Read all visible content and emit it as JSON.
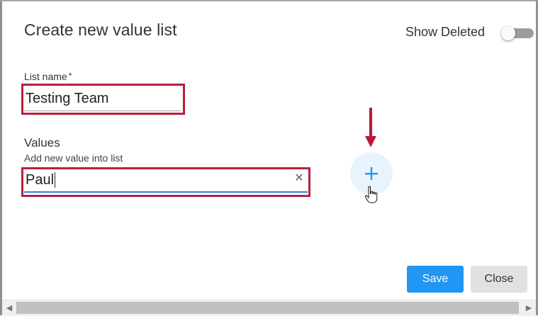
{
  "dialog": {
    "title": "Create new value list",
    "show_deleted_label": "Show Deleted",
    "show_deleted_on": false
  },
  "list_name": {
    "label": "List name",
    "required_mark": "*",
    "value": "Testing Team"
  },
  "values": {
    "heading": "Values",
    "input_label": "Add new value into list",
    "input_value": "Paul",
    "clear_icon": "close-icon",
    "add_icon": "plus-icon"
  },
  "footer": {
    "save_label": "Save",
    "close_label": "Close"
  },
  "colors": {
    "highlight": "#b5213f",
    "primary": "#2196f3",
    "underline_focus": "#2f7fd8",
    "arrow": "#c0183a"
  }
}
